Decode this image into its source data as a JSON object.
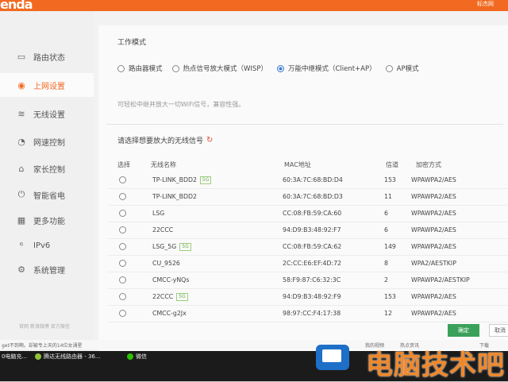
{
  "brand": {
    "logo": "enda"
  },
  "top_right": {
    "user": "标杰网"
  },
  "sidebar": {
    "items": [
      {
        "label": "路由状态",
        "icon": "monitor-icon"
      },
      {
        "label": "上网设置",
        "icon": "globe-icon"
      },
      {
        "label": "无线设置",
        "icon": "wifi-icon"
      },
      {
        "label": "网速控制",
        "icon": "speed-icon"
      },
      {
        "label": "家长控制",
        "icon": "home-icon"
      },
      {
        "label": "智能省电",
        "icon": "power-icon"
      },
      {
        "label": "更多功能",
        "icon": "grid-icon"
      },
      {
        "label": "IPv6",
        "icon": "ipv6-icon"
      },
      {
        "label": "系统管理",
        "icon": "gear-icon"
      }
    ],
    "active_index": 1,
    "footer": "官网  新浪微博  官方微信"
  },
  "work_mode": {
    "title": "工作模式",
    "options": [
      "路由器模式",
      "热点信号放大模式（WISP）",
      "万能中继模式（Client+AP）",
      "AP模式"
    ],
    "selected_index": 2,
    "hint": "可轻松中继并放大一切WiFi信号，兼容性强。"
  },
  "signal_select": {
    "title": "请选择想要放大的无线信号"
  },
  "table": {
    "headers": [
      "选择",
      "无线名称",
      "MAC地址",
      "信道",
      "加密方式"
    ],
    "rows": [
      {
        "ssid": "TP-LINK_BDD2",
        "tag": "5G",
        "mac": "60:3A:7C:68:BD:D4",
        "channel": "153",
        "security": "WPAWPA2/AES"
      },
      {
        "ssid": "TP-LINK_BDD2",
        "tag": "",
        "mac": "60:3A:7C:68:BD:D3",
        "channel": "11",
        "security": "WPAWPA2/AES"
      },
      {
        "ssid": "LSG",
        "tag": "",
        "mac": "CC:08:FB:59:CA:60",
        "channel": "6",
        "security": "WPAWPA2/AES"
      },
      {
        "ssid": "22CCC",
        "tag": "",
        "mac": "94:D9:B3:48:92:F7",
        "channel": "6",
        "security": "WPAWPA2/AES"
      },
      {
        "ssid": "LSG_5G",
        "tag": "5G",
        "mac": "CC:08:FB:59:CA:62",
        "channel": "149",
        "security": "WPAWPA2/AES"
      },
      {
        "ssid": "CU_9526",
        "tag": "",
        "mac": "2C:CC:E6:EF:4D:72",
        "channel": "8",
        "security": "WPA2/AESTKIP"
      },
      {
        "ssid": "CMCC-yNQs",
        "tag": "",
        "mac": "58:F9:87:C6:32:3C",
        "channel": "2",
        "security": "WPAWPA2/AESTKIP"
      },
      {
        "ssid": "22CCC",
        "tag": "5G",
        "mac": "94:D9:B3:48:92:F9",
        "channel": "153",
        "security": "WPAWPA2/AES"
      },
      {
        "ssid": "CMCC-g2Jx",
        "tag": "",
        "mac": "98:97:CC:F4:17:38",
        "channel": "12",
        "security": "WPAWPA2/AES"
      }
    ]
  },
  "buttons": {
    "ok": "确定",
    "cancel": "取消"
  },
  "news": {
    "left": "get不到啊。却被专上天的14位女涌星",
    "right1": "我的视频",
    "right2": "热点资讯",
    "right3": "下载"
  },
  "taskbar": {
    "item1": "0电脑充...",
    "item2": "腾达无线路由器 - 36...",
    "item3": "微信"
  },
  "watermark": {
    "text": "电脑技术吧"
  },
  "colors": {
    "brand_orange": "#f26a21",
    "ok_green": "#3aa15a",
    "radio_blue": "#3b7bd6"
  }
}
